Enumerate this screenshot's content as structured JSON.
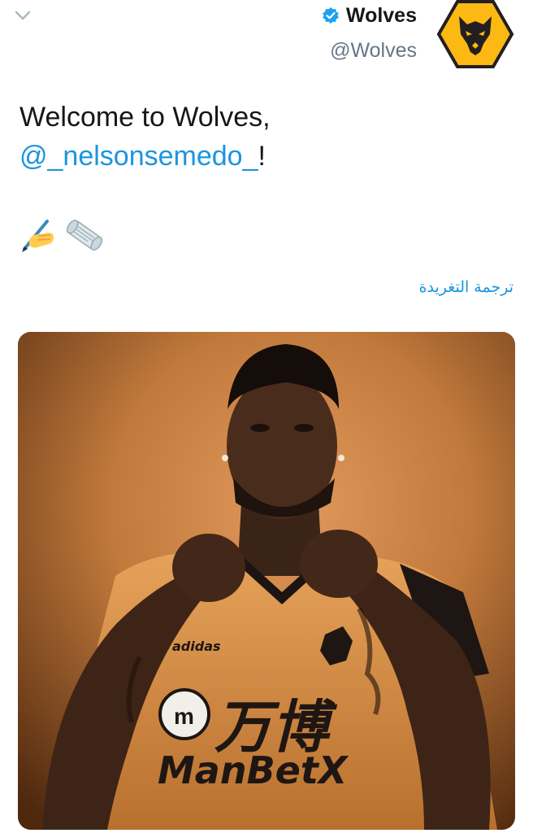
{
  "header": {
    "display_name": "Wolves",
    "handle": "@Wolves",
    "verified": true,
    "icons": {
      "menu": "chevron-down-icon",
      "verified": "verified-badge-icon",
      "avatar": "wolf-head-logo"
    }
  },
  "tweet": {
    "text_line1": "Welcome to Wolves,",
    "mention": "@_nelsonsemedo_",
    "text_suffix": "!",
    "emojis": [
      "writing-hand-emoji",
      "scroll-emoji"
    ],
    "translate_label": "ترجمة التغريدة"
  },
  "media": {
    "kit_brand": "adidas",
    "sponsor_chinese": "万博",
    "sponsor_latin": "ManBetX"
  },
  "colors": {
    "link": "#1b95e0",
    "text": "#14171a",
    "secondary": "#657786",
    "wolves_gold": "#fdb913",
    "wolves_black": "#231f20"
  }
}
